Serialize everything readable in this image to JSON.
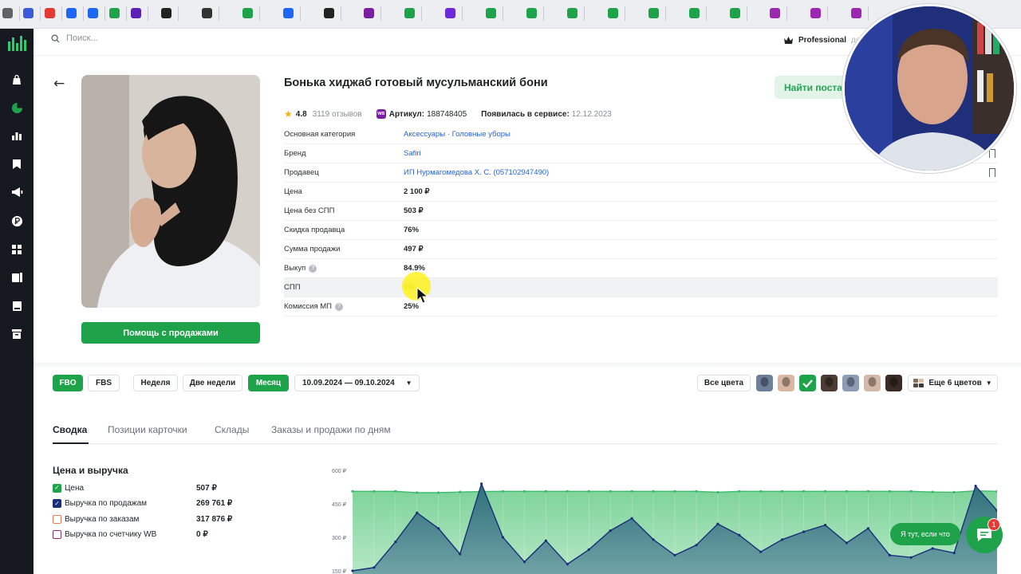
{
  "header": {
    "search_placeholder": "Поиск...",
    "plan": "Professional",
    "plan_rest": "до"
  },
  "product": {
    "title": "Бонька хиджаб готовый мусульманский бони",
    "rating": "4.8",
    "reviews": "3119 отзывов",
    "article_label": "Артикул:",
    "article_value": "188748405",
    "appeared_label": "Появилась в сервисе:",
    "appeared_value": "12.12.2023",
    "find_button": "Найти поста",
    "help_button": "Помощь с продажами",
    "wb_badge": "WB",
    "attributes": [
      {
        "key": "Основная категория",
        "value": "Аксессуары · Головные уборы",
        "link": true,
        "info": false,
        "bookmark": false
      },
      {
        "key": "Бренд",
        "value": "Safiri",
        "link": true,
        "info": false,
        "bookmark": true
      },
      {
        "key": "Продавец",
        "value": "ИП Нурмагомедова Х. С. (057102947490)",
        "link": true,
        "info": false,
        "bookmark": true
      },
      {
        "key": "Цена",
        "value": "2 100 ₽",
        "link": false,
        "info": false,
        "bookmark": false
      },
      {
        "key": "Цена без СПП",
        "value": "503 ₽",
        "link": false,
        "info": false,
        "bookmark": false
      },
      {
        "key": "Скидка продавца",
        "value": "76%",
        "link": false,
        "info": false,
        "bookmark": false
      },
      {
        "key": "Сумма продажи",
        "value": "497 ₽",
        "link": false,
        "info": false,
        "bookmark": false
      },
      {
        "key": "Выкуп",
        "value": "84.9%",
        "link": false,
        "info": true,
        "bookmark": false
      },
      {
        "key": "СПП",
        "value": "1%",
        "link": false,
        "info": false,
        "bookmark": false,
        "highlight": true
      },
      {
        "key": "Комиссия МП",
        "value": "25%",
        "link": false,
        "info": true,
        "bookmark": false
      }
    ]
  },
  "filters": {
    "fbo": "FBO",
    "fbs": "FBS",
    "week": "Неделя",
    "two_weeks": "Две недели",
    "month": "Месяц",
    "date_range": "10.09.2024 — 09.10.2024",
    "all_colors": "Все цвета",
    "more_colors": "Еще 6 цветов"
  },
  "tabs": [
    "Сводка",
    "Позиции карточки",
    "Склады",
    "Заказы и продажи по дням"
  ],
  "summary": {
    "title": "Цена и выручка",
    "legend": [
      {
        "label": "Цена",
        "value": "507 ₽",
        "checked": true,
        "color": "#1fa34a"
      },
      {
        "label": "Выручка по продажам",
        "value": "269 761 ₽",
        "checked": true,
        "color": "#1a2d7a"
      },
      {
        "label": "Выручка по заказам",
        "value": "317 876 ₽",
        "checked": false,
        "color": "#e67e5a"
      },
      {
        "label": "Выручка по счетчику WB",
        "value": "0 ₽",
        "checked": false,
        "color": "#9b2c6b"
      }
    ]
  },
  "chart_data": {
    "type": "area",
    "y_ticks": [
      "600 ₽",
      "450 ₽",
      "300 ₽",
      "150 ₽"
    ],
    "ylim": [
      150,
      600
    ],
    "series": [
      {
        "name": "Цена",
        "color": "#3dbb6a",
        "values": [
          506,
          506,
          506,
          500,
          500,
          503,
          505,
          506,
          506,
          506,
          506,
          506,
          506,
          506,
          506,
          506,
          506,
          502,
          506,
          506,
          506,
          506,
          506,
          506,
          506,
          506,
          506,
          503,
          502,
          508,
          506
        ]
      },
      {
        "name": "Выручка по продажам",
        "color": "#1a2d7a",
        "values": [
          150,
          165,
          280,
          410,
          340,
          225,
          540,
          300,
          190,
          285,
          180,
          245,
          330,
          385,
          290,
          220,
          265,
          360,
          310,
          235,
          290,
          325,
          355,
          275,
          340,
          220,
          210,
          250,
          230,
          530,
          420
        ]
      }
    ]
  },
  "chat": {
    "bubble": "Я тут, если что",
    "badge": "1"
  }
}
